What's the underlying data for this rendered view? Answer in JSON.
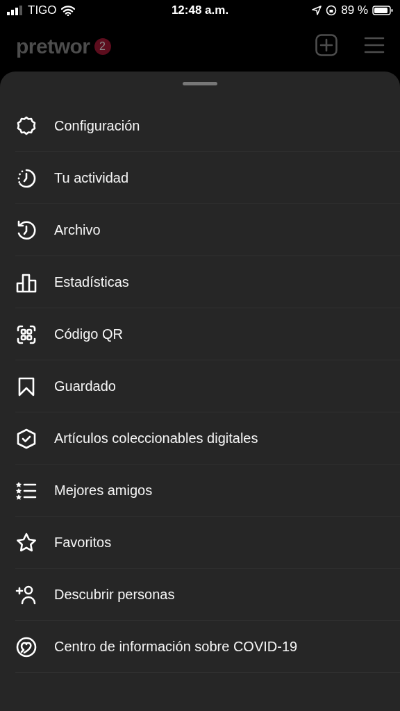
{
  "status_bar": {
    "carrier": "TIGO",
    "time": "12:48 a.m.",
    "battery": "89 %"
  },
  "header": {
    "username": "pretwor",
    "badge": "2"
  },
  "menu": [
    {
      "kind": "settings",
      "label": "Configuración"
    },
    {
      "kind": "activity",
      "label": "Tu actividad"
    },
    {
      "kind": "archive",
      "label": "Archivo"
    },
    {
      "kind": "stats",
      "label": "Estadísticas"
    },
    {
      "kind": "qr",
      "label": "Código QR"
    },
    {
      "kind": "saved",
      "label": "Guardado"
    },
    {
      "kind": "collectibles",
      "label": "Artículos coleccionables digitales"
    },
    {
      "kind": "close_friends",
      "label": "Mejores amigos"
    },
    {
      "kind": "favorites",
      "label": "Favoritos"
    },
    {
      "kind": "discover",
      "label": "Descubrir personas"
    },
    {
      "kind": "covid",
      "label": "Centro de información sobre COVID-19"
    }
  ]
}
